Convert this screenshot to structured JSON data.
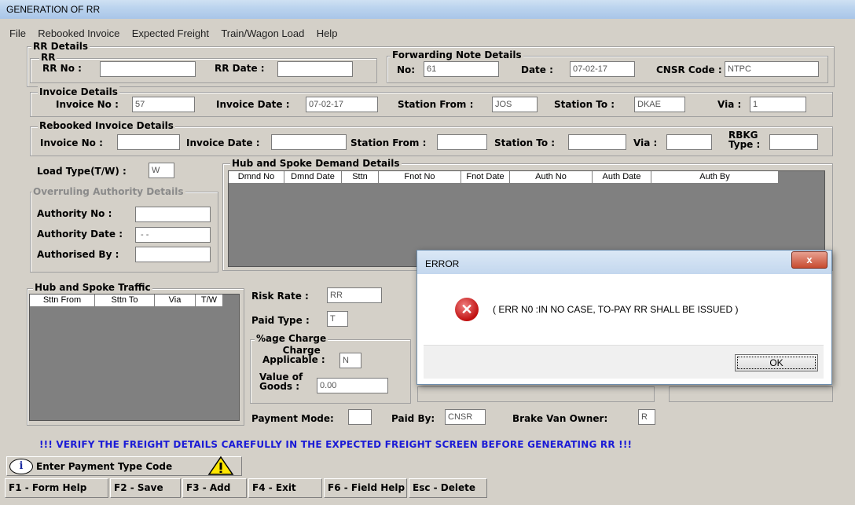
{
  "window": {
    "title": "GENERATION OF RR"
  },
  "menu": [
    "File",
    "Rebooked Invoice",
    "Expected Freight",
    "Train/Wagon Load",
    "Help"
  ],
  "rr_details": {
    "legend": "RR Details",
    "rr_legend": "RR",
    "rr_no_label": "RR No :",
    "rr_no": "",
    "rr_date_label": "RR Date :",
    "rr_date": ""
  },
  "forwarding": {
    "legend": "Forwarding Note Details",
    "no_label": "No:",
    "no": "61",
    "date_label": "Date :",
    "date": "07-02-17",
    "cnsr_label": "CNSR Code :",
    "cnsr": "NTPC"
  },
  "invoice": {
    "legend": "Invoice Details",
    "no_label": "Invoice No :",
    "no": "57",
    "date_label": "Invoice Date :",
    "date": "07-02-17",
    "from_label": "Station From :",
    "from": "JOS",
    "to_label": "Station To :",
    "to": "DKAE",
    "via_label": "Via :",
    "via": "1"
  },
  "rebooked": {
    "legend": "Rebooked Invoice Details",
    "no_label": "Invoice No :",
    "no": "",
    "date_label": "Invoice Date :",
    "date": "",
    "from_label": "Station From :",
    "from": "",
    "to_label": "Station To :",
    "to": "",
    "via_label": "Via :",
    "via": "",
    "rbkg_label1": "RBKG",
    "rbkg_label2": "Type :",
    "rbkg": ""
  },
  "load_type": {
    "label": "Load Type(T/W) :",
    "value": "W"
  },
  "overruling": {
    "legend": "Overruling Authority Details",
    "no_label": "Authority No :",
    "no": "",
    "date_label": "Authority Date :",
    "date": " - -",
    "by_label": "Authorised By :",
    "by": ""
  },
  "demand": {
    "legend": "Hub and Spoke Demand Details",
    "columns": [
      "Dmnd No",
      "Dmnd Date",
      "Sttn",
      "Fnot No",
      "Fnot Date",
      "Auth No",
      "Auth Date",
      "Auth By"
    ]
  },
  "traffic": {
    "legend": "Hub and Spoke Traffic",
    "columns": [
      "Sttn From",
      "Sttn To",
      "Via",
      "T/W"
    ]
  },
  "risk": {
    "label": "Risk Rate :",
    "value": "RR"
  },
  "paid_type": {
    "label": "Paid Type :",
    "value": "T"
  },
  "charge": {
    "legend": "%age Charge",
    "applicable_label1": "Charge",
    "applicable_label2": "Applicable :",
    "applicable": "N",
    "value_label1": "Value of",
    "value_label2": "Goods :",
    "value": "0.00"
  },
  "payment": {
    "mode_label": "Payment Mode:",
    "mode": "",
    "paid_by_label": "Paid By:",
    "paid_by": "CNSR",
    "brake_label": "Brake Van Owner:",
    "brake": "R"
  },
  "warning": "!!! VERIFY THE FREIGHT DETAILS CAREFULLY IN THE EXPECTED FREIGHT SCREEN BEFORE GENERATING RR !!!",
  "status": {
    "message": "Enter Payment Type Code"
  },
  "fkeys": [
    "F1 - Form Help",
    "F2 - Save",
    "F3 - Add",
    "F4 - Exit",
    "F6 - Field Help",
    "Esc - Delete"
  ],
  "dialog": {
    "title": "ERROR",
    "close": "x",
    "message": "( ERR N0 :IN NO CASE, TO-PAY RR SHALL BE ISSUED )",
    "ok": "OK"
  },
  "colors": {
    "warning_text": "#1b1bd6",
    "error_icon": "#c01010",
    "grid_bg": "#808080"
  }
}
